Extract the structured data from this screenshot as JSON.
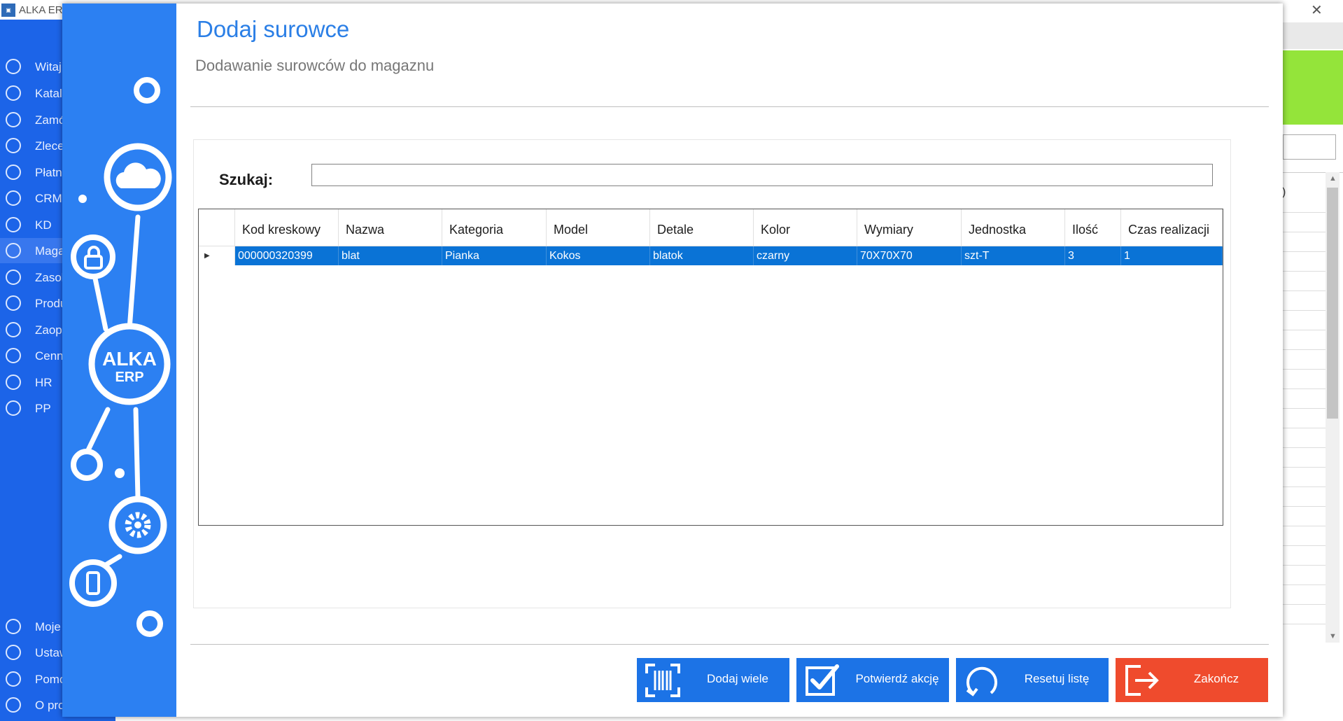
{
  "background_app": {
    "title": "ALKA ERP",
    "nav_items": [
      {
        "label": "Witaj",
        "active": false
      },
      {
        "label": "Katalo",
        "active": false
      },
      {
        "label": "Zamó",
        "active": false
      },
      {
        "label": "Zlece",
        "active": false
      },
      {
        "label": "Płatno",
        "active": false
      },
      {
        "label": "CRM",
        "active": false
      },
      {
        "label": "KD",
        "active": false
      },
      {
        "label": "Maga",
        "active": true
      },
      {
        "label": "Zasob",
        "active": false
      },
      {
        "label": "Produ",
        "active": false
      },
      {
        "label": "Zaop",
        "active": false
      },
      {
        "label": "Cenni",
        "active": false
      },
      {
        "label": "HR",
        "active": false
      },
      {
        "label": "PP",
        "active": false
      }
    ],
    "bottom_nav_items": [
      {
        "label": "Moje"
      },
      {
        "label": "Ustaw"
      },
      {
        "label": "Pomo"
      },
      {
        "label": "O pro"
      }
    ],
    "list_fragment": ")",
    "accent_color": "#94e43a",
    "sidebar_color": "#1c64e8"
  },
  "dialog": {
    "title": "Dodaj surowce",
    "subtitle": "Dodawanie surowców do magaznu",
    "logo_text": "ALKA",
    "logo_subtext": "ERP",
    "search": {
      "label": "Szukaj:",
      "value": "",
      "placeholder": ""
    },
    "grid": {
      "columns": [
        "Kod kreskowy",
        "Nazwa",
        "Kategoria",
        "Model",
        "Detale",
        "Kolor",
        "Wymiary",
        "Jednostka",
        "Ilość",
        "Czas realizacji"
      ],
      "rows": [
        [
          "000000320399",
          "blat",
          "Pianka",
          "Kokos",
          "blatok",
          "czarny",
          "70X70X70",
          "szt-T",
          "3",
          "1"
        ]
      ],
      "selected_row": 0
    },
    "buttons": {
      "add_many": "Dodaj wiele",
      "confirm": "Potwierdź akcję",
      "reset": "Resetuj listę",
      "finish": "Zakończ"
    },
    "colors": {
      "title": "#2b7fe6",
      "deco_panel": "#2c80f2",
      "button_primary": "#1c73e6",
      "button_finish": "#ef4b2d",
      "selection": "#0a73d6"
    }
  }
}
